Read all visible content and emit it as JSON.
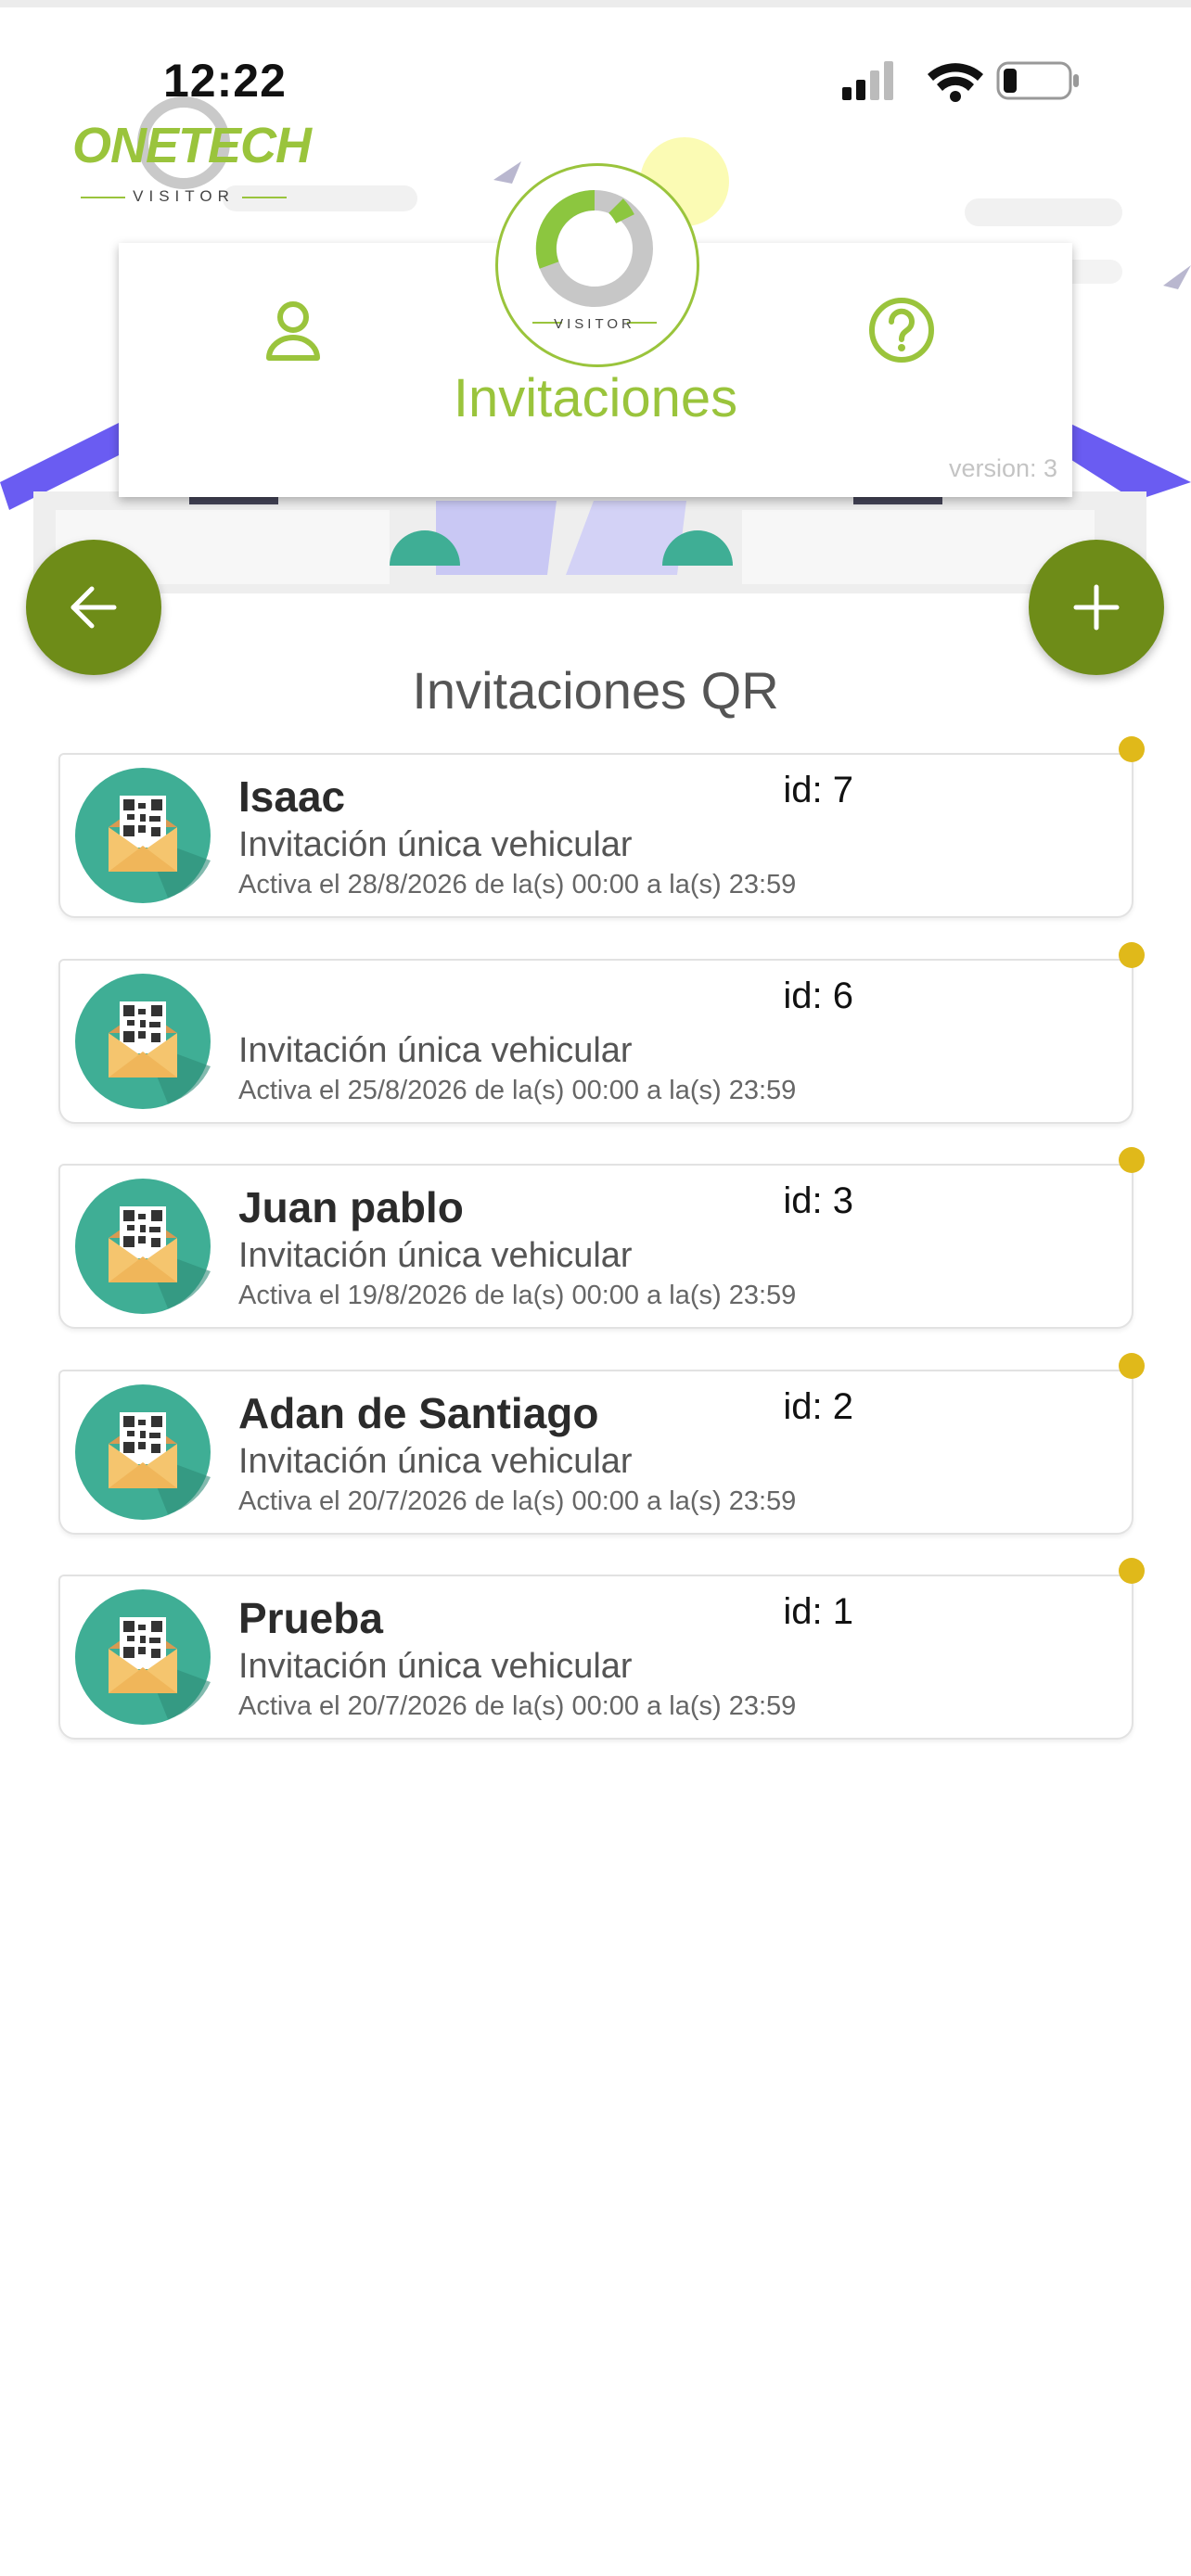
{
  "status_bar": {
    "time": "12:22"
  },
  "logo": {
    "name": "ONETECH",
    "subtitle": "VISITOR"
  },
  "header": {
    "title": "Invitaciones",
    "emblem_label": "VISITOR",
    "version": "version: 3",
    "icons": [
      "user-icon",
      "help-icon"
    ]
  },
  "section_title": "Invitaciones QR",
  "colors": {
    "accent_green": "#9ac43c",
    "fab_green": "#6e8c18",
    "status_dot": "#e0b91a",
    "icon_teal": "#3fae95"
  },
  "invitations": [
    {
      "name": "Isaac",
      "id_label": "id: 7",
      "type": "Invitación única vehicular",
      "schedule": "Activa  el 28/8/2026 de la(s) 00:00 a la(s) 23:59"
    },
    {
      "name": "",
      "id_label": "id: 6",
      "type": "Invitación única vehicular",
      "schedule": "Activa  el 25/8/2026 de la(s) 00:00 a la(s) 23:59"
    },
    {
      "name": "Juan pablo",
      "id_label": "id: 3",
      "type": "Invitación única vehicular",
      "schedule": "Activa  el 19/8/2026 de la(s) 00:00 a la(s) 23:59"
    },
    {
      "name": "Adan de Santiago",
      "id_label": "id: 2",
      "type": "Invitación única vehicular",
      "schedule": "Activa  el 20/7/2026 de la(s) 00:00 a la(s) 23:59"
    },
    {
      "name": "Prueba",
      "id_label": "id: 1",
      "type": "Invitación única vehicular",
      "schedule": "Activa  el 20/7/2026 de la(s) 00:00 a la(s) 23:59"
    }
  ]
}
